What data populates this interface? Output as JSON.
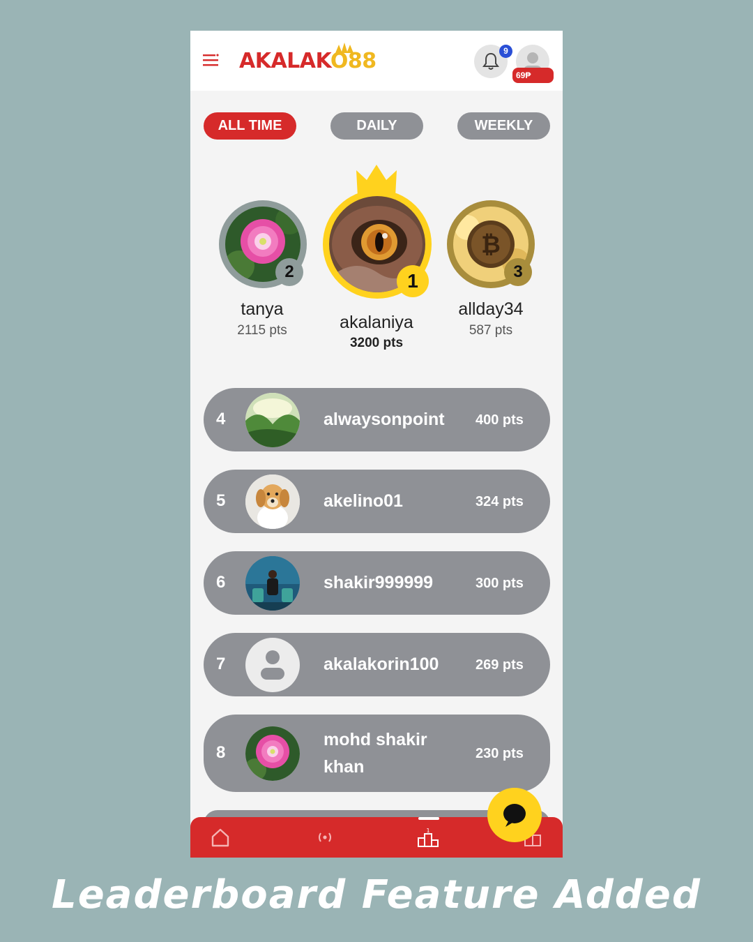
{
  "app": {
    "logo_text_red": "AKALAK",
    "logo_text_gold": "O88",
    "notification_count": "9",
    "coins": "69₱"
  },
  "tabs": [
    {
      "label": "ALL TIME",
      "active": true
    },
    {
      "label": "DAILY",
      "active": false
    },
    {
      "label": "WEEKLY",
      "active": false
    }
  ],
  "podium": [
    {
      "rank": "2",
      "name": "tanya",
      "points": "2115 pts",
      "avatar": "pink-flower"
    },
    {
      "rank": "1",
      "name": "akalaniya",
      "points": "3200 pts",
      "avatar": "owl-eye"
    },
    {
      "rank": "3",
      "name": "allday34",
      "points": "587 pts",
      "avatar": "bitcoin-coin"
    }
  ],
  "leaderboard": [
    {
      "rank": "4",
      "name": "alwaysonpoint",
      "points": "400 pts",
      "avatar": "forest-landscape"
    },
    {
      "rank": "5",
      "name": "akelino01",
      "points": "324 pts",
      "avatar": "golden-retriever-dog"
    },
    {
      "rank": "6",
      "name": "shakir999999",
      "points": "300 pts",
      "avatar": "person-in-lounge"
    },
    {
      "rank": "7",
      "name": "akalakorin100",
      "points": "269 pts",
      "avatar": "default-user"
    },
    {
      "rank": "8",
      "name": "mohd shakir khan",
      "points": "230 pts",
      "avatar": "pink-flower"
    }
  ],
  "bottom_nav": [
    {
      "icon": "home-icon"
    },
    {
      "icon": "live-broadcast-icon"
    },
    {
      "icon": "leaderboard-icon"
    },
    {
      "icon": "gift-icon"
    }
  ],
  "caption": "Leaderboard Feature Added",
  "colors": {
    "brand_red": "#d62a2a",
    "brand_gold": "#f0b820",
    "crown_yellow": "#ffd21e",
    "row_gray": "#8f9196",
    "background": "#9ab4b5"
  }
}
